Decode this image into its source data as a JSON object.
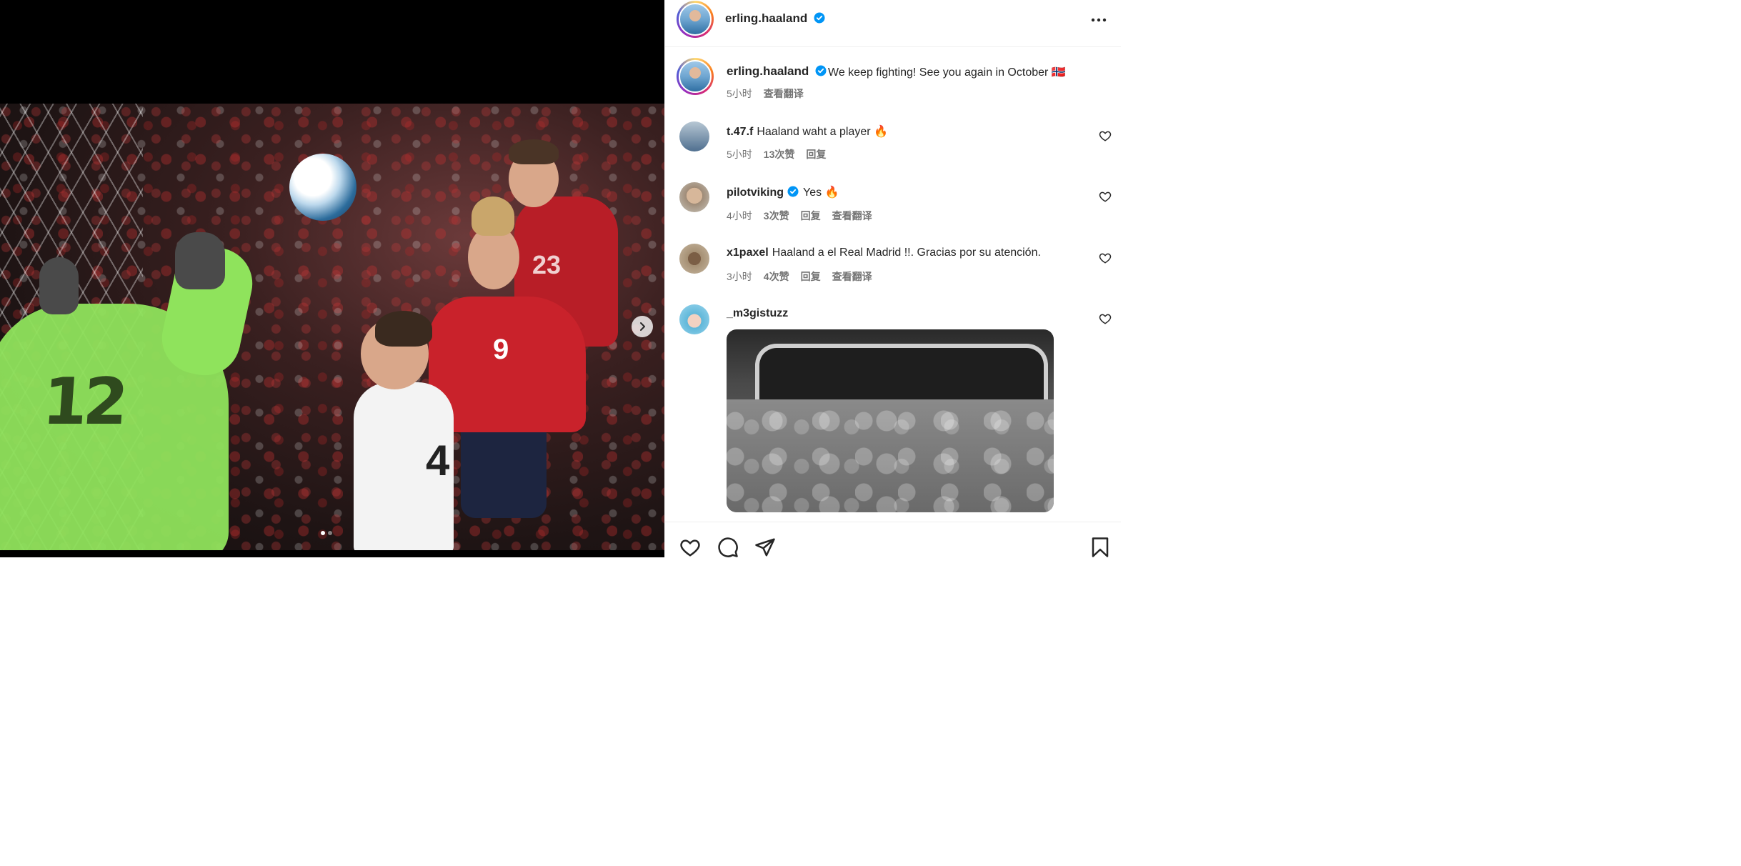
{
  "post": {
    "image_alt": "Football match photo",
    "carousel_total": 2,
    "carousel_index": 1
  },
  "header": {
    "username": "erling.haaland",
    "verified": true
  },
  "caption": {
    "username": "erling.haaland",
    "text": "We keep fighting! See you again in October",
    "flag_emoji": "🇳🇴",
    "time": "5小时",
    "translate": "查看翻译"
  },
  "comments": [
    {
      "username": "t.47.f",
      "verified": false,
      "text": "Haaland waht a player 🔥",
      "time": "5小时",
      "likes": "13次赞",
      "reply": "回复",
      "translate": ""
    },
    {
      "username": "pilotviking",
      "verified": true,
      "text": "Yes 🔥",
      "time": "4小时",
      "likes": "3次赞",
      "reply": "回复",
      "translate": "查看翻译"
    },
    {
      "username": "x1paxel",
      "verified": false,
      "text": "Haaland a el Real Madrid !!. Gracias por su atención.",
      "time": "3小时",
      "likes": "4次赞",
      "reply": "回复",
      "translate": "查看翻译"
    },
    {
      "username": "_m3gistuzz",
      "verified": false,
      "text": "",
      "time": "",
      "likes": "",
      "reply": "",
      "translate": ""
    }
  ],
  "colors": {
    "verified": "#0095f6",
    "meta": "#737373",
    "text": "#262626"
  },
  "icons": [
    "more-icon",
    "verified-icon",
    "heart-icon",
    "comment-icon",
    "share-icon",
    "save-icon",
    "chevron-right-icon"
  ]
}
